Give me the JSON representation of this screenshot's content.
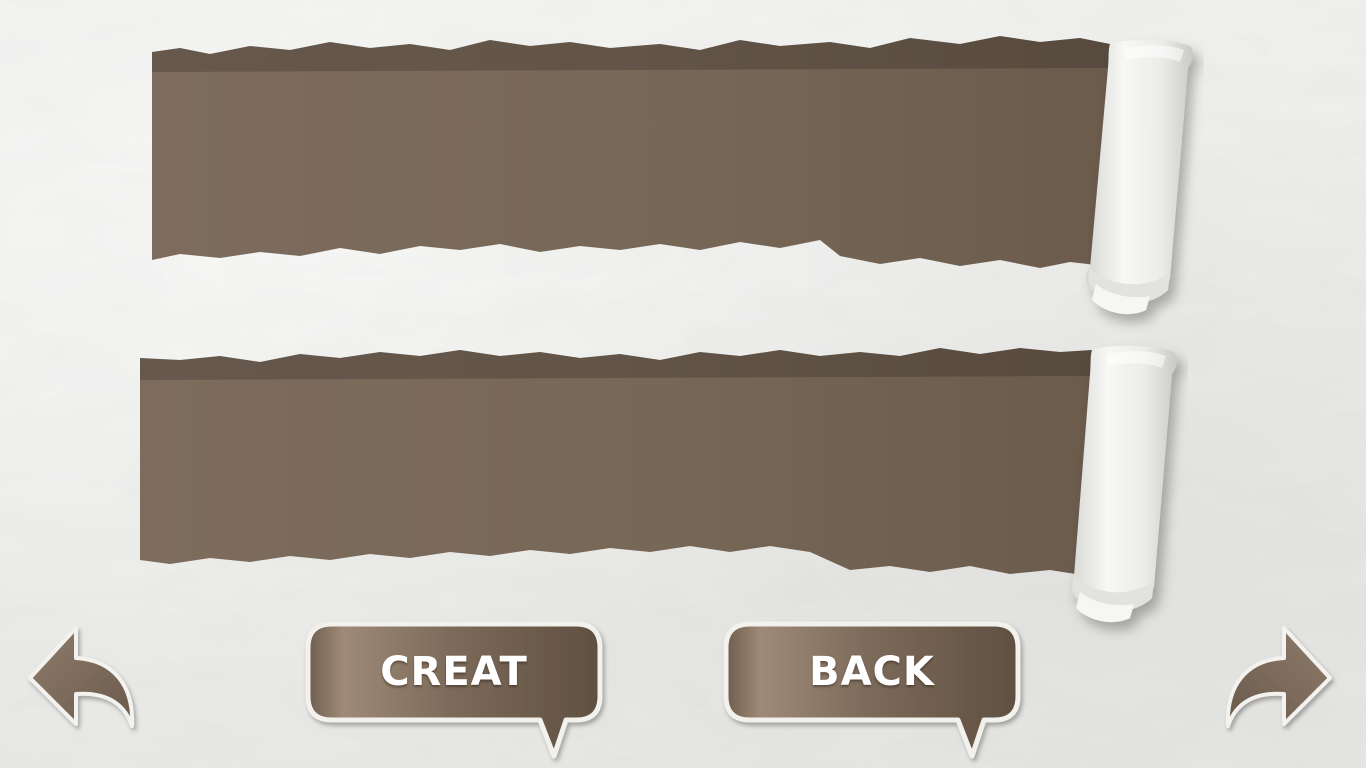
{
  "colors": {
    "paper": "#ededeb",
    "slot_brown": "#7a6a5b",
    "button_brown": "#7d6b5b",
    "button_border": "#f3f1ec",
    "label_text": "#ffffff"
  },
  "panels": [
    {
      "name": "name-slot-1"
    },
    {
      "name": "name-slot-2"
    }
  ],
  "buttons": {
    "create_label": "CREAT",
    "back_label": "BACK"
  },
  "icons": {
    "previous": "curved-arrow-left-icon",
    "next": "curved-arrow-right-icon"
  }
}
